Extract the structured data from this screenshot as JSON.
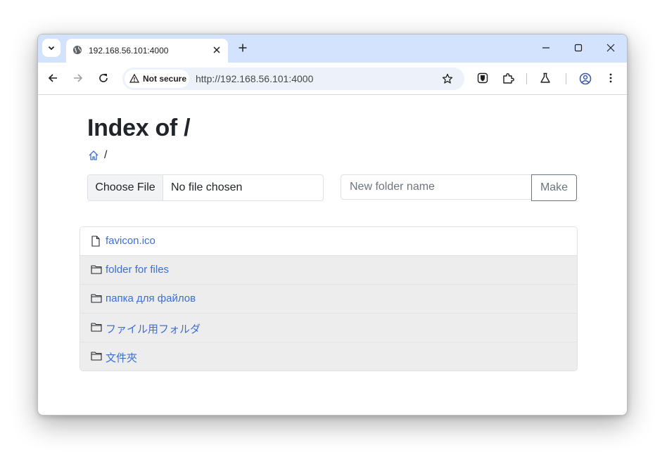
{
  "browser": {
    "tab_title": "192.168.56.101:4000",
    "security_chip": "Not secure",
    "url": "http://192.168.56.101:4000"
  },
  "page": {
    "title": "Index of /",
    "breadcrumb_separator": "/",
    "upload": {
      "choose_label": "Choose File",
      "status": "No file chosen"
    },
    "new_folder": {
      "placeholder": "New folder name",
      "button_label": "Make"
    },
    "entries": [
      {
        "name": "favicon.ico",
        "type": "file"
      },
      {
        "name": "folder for files",
        "type": "folder"
      },
      {
        "name": "папка для файлов",
        "type": "folder"
      },
      {
        "name": "ファイル用フォルダ",
        "type": "folder"
      },
      {
        "name": "文件夾",
        "type": "folder"
      }
    ]
  },
  "colors": {
    "tabbar": "#d3e3fd",
    "link": "#3b6fd1",
    "row_bg": "#ededed"
  }
}
